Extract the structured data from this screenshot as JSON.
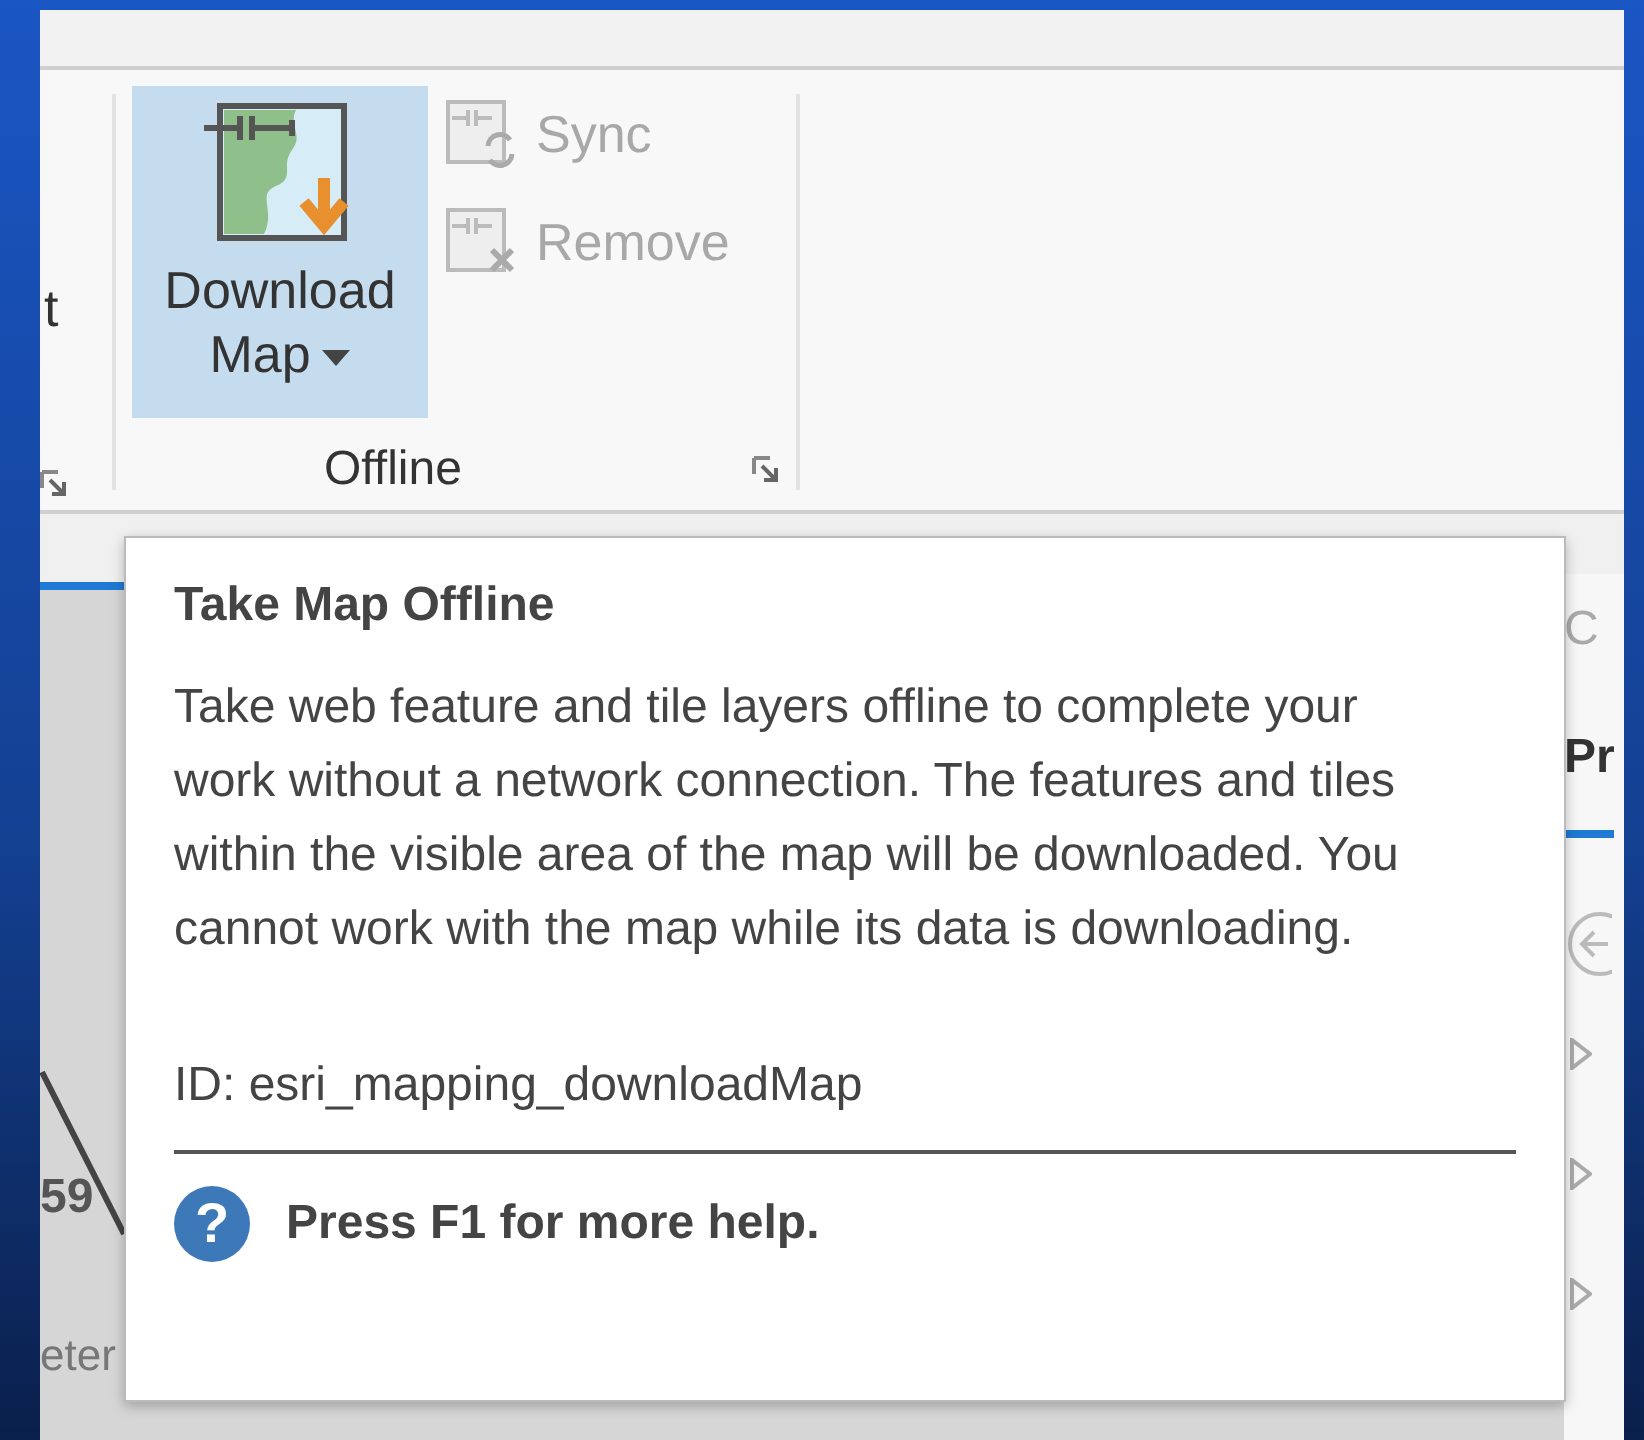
{
  "ribbon": {
    "left_group": {
      "label": "t"
    },
    "groups": [
      {
        "title": "Offline",
        "buttons": [
          {
            "label": "Download Map",
            "kind": "large",
            "highlighted": true,
            "dropdown": true,
            "disabled": false
          },
          {
            "label": "Sync",
            "kind": "small",
            "highlighted": false,
            "disabled": true
          },
          {
            "label": "Remove",
            "kind": "small",
            "highlighted": false,
            "disabled": true
          }
        ]
      }
    ]
  },
  "map": {
    "labels": [
      "59",
      "eter"
    ]
  },
  "side_pane": {
    "tabs": [
      {
        "label": "C",
        "selected": false
      },
      {
        "label": "Pr",
        "selected": true
      }
    ]
  },
  "tooltip": {
    "title": "Take Map Offline",
    "description": "Take web feature and tile layers offline to complete your work without a network connection. The features and tiles within the visible area of the map will be downloaded. You cannot work with the map while its data is downloading.",
    "id": "ID: esri_mapping_downloadMap",
    "help_icon": "?",
    "help": "Press F1 for more help."
  }
}
